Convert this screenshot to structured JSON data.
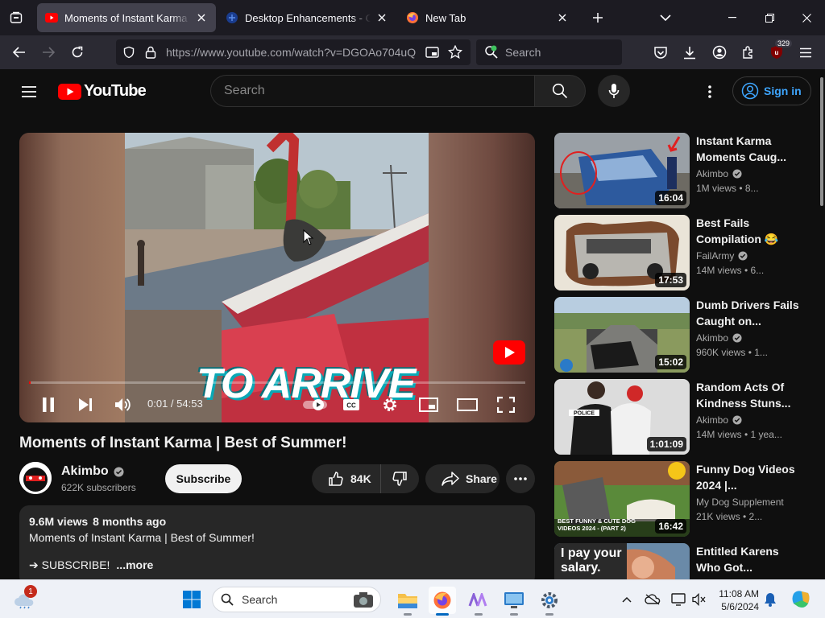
{
  "browser": {
    "tabs": [
      {
        "title": "Moments of Instant Karma | Best",
        "active": true
      },
      {
        "title": "Desktop Enhancements - Other",
        "active": false
      },
      {
        "title": "New Tab",
        "active": false
      }
    ],
    "url": "https://www.youtube.com/watch?v=DGOAo704uQ",
    "search_placeholder": "Search",
    "extension_badge": "329"
  },
  "youtube": {
    "logo_text": "YouTube",
    "search_placeholder": "Search",
    "sign_in": "Sign in"
  },
  "player": {
    "current_time": "0:01",
    "duration": "54:53",
    "progress": 0.0003,
    "overlay_caption": "TO ARRIVE"
  },
  "video": {
    "title": "Moments of Instant Karma | Best of Summer!",
    "channel": "Akimbo",
    "subscribers": "622K subscribers",
    "subscribe_label": "Subscribe",
    "likes": "84K",
    "share_label": "Share",
    "views": "9.6M views",
    "age": "8 months ago",
    "description_line1": "Moments of Instant Karma | Best of Summer!",
    "description_line2": "➔ SUBSCRIBE!",
    "more_label": "...more"
  },
  "recommendations": [
    {
      "title": "Instant Karma Moments Caug...",
      "channel": "Akimbo",
      "verified": true,
      "meta": "1M views • 8...",
      "duration": "16:04",
      "thumb_color": "#2d5a9e"
    },
    {
      "title": "Best Fails Compilation 😂",
      "channel": "FailArmy",
      "verified": true,
      "meta": "14M views • 6...",
      "duration": "17:53",
      "thumb_color": "#c7c2b8"
    },
    {
      "title": "Dumb Drivers Fails Caught on...",
      "channel": "Akimbo",
      "verified": true,
      "meta": "960K views • 1...",
      "duration": "15:02",
      "thumb_color": "#7f8a6a"
    },
    {
      "title": "Random Acts Of Kindness Stuns...",
      "channel": "Akimbo",
      "verified": true,
      "meta": "14M views • 1 yea...",
      "duration": "1:01:09",
      "thumb_color": "#d6d6d6"
    },
    {
      "title": "Funny Dog Videos 2024 |...",
      "channel": "My Dog Supplement",
      "verified": false,
      "meta": "21K views • 2...",
      "duration": "16:42",
      "thumb_color": "#6a9a4a",
      "thumb_caption": "BEST FUNNY & CUTE DOG VIDEOS 2024 - (PART 2)"
    },
    {
      "title": "Entitled Karens Who Got...",
      "channel": "",
      "verified": false,
      "meta": "",
      "duration": "",
      "thumb_color": "#c97f5a",
      "thumb_caption": "I pay your salary."
    }
  ],
  "taskbar": {
    "search_placeholder": "Search",
    "weather_notification": "1",
    "time": "11:08 AM",
    "date": "5/6/2024"
  },
  "colors": {
    "yt_red": "#ff0000",
    "link_blue": "#3ea6ff",
    "browser_dark": "#1c1b22"
  }
}
